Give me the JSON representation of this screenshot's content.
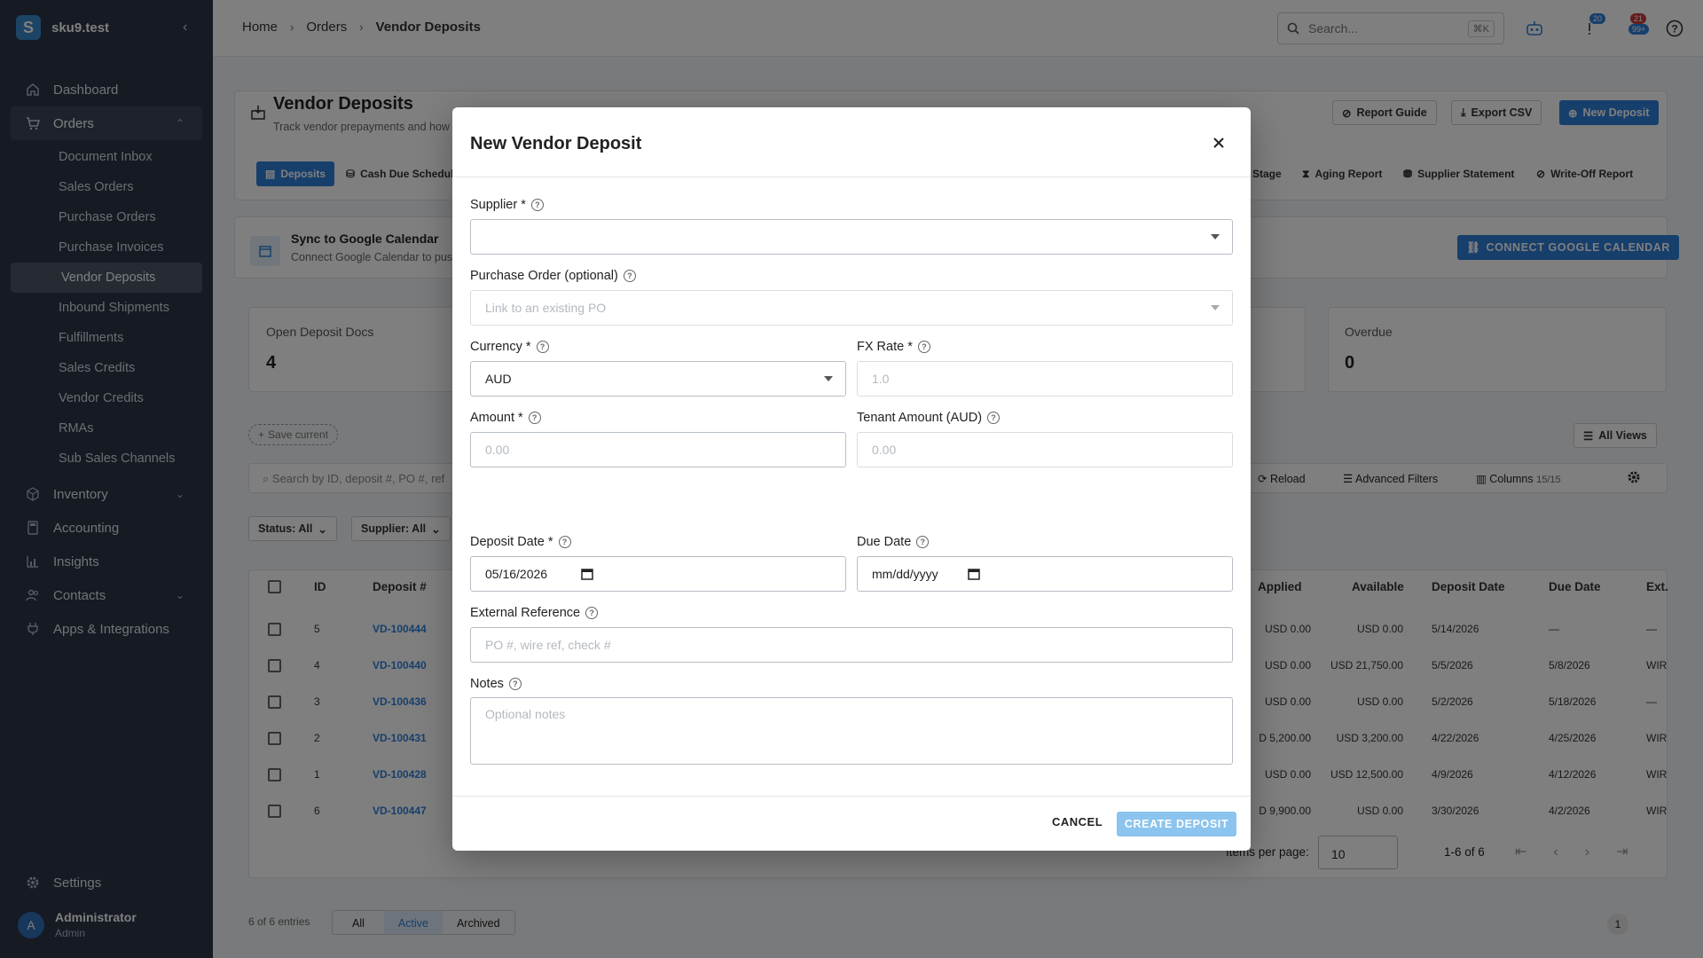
{
  "brand": {
    "logo": "S",
    "name": "sku9.test"
  },
  "sidebar": {
    "items": [
      {
        "label": "Dashboard",
        "icon": "home-icon"
      },
      {
        "label": "Orders",
        "icon": "cart-icon"
      },
      {
        "label": "Inventory",
        "icon": "box-icon"
      },
      {
        "label": "Accounting",
        "icon": "calculator-icon"
      },
      {
        "label": "Insights",
        "icon": "chart-icon"
      },
      {
        "label": "Contacts",
        "icon": "people-icon"
      },
      {
        "label": "Apps & Integrations",
        "icon": "plug-icon"
      }
    ],
    "orders_sub": [
      "Document Inbox",
      "Sales Orders",
      "Purchase Orders",
      "Purchase Invoices",
      "Vendor Deposits",
      "Inbound Shipments",
      "Fulfillments",
      "Sales Credits",
      "Vendor Credits",
      "RMAs",
      "Sub Sales Channels"
    ],
    "settings": "Settings",
    "user": {
      "initial": "A",
      "name": "Administrator",
      "role": "Admin"
    }
  },
  "topbar": {
    "breadcrumbs": [
      "Home",
      "Orders",
      "Vendor Deposits"
    ],
    "search_placeholder": "Search...",
    "search_shortcut": "⌘K",
    "badge_one": "20",
    "badge_two_top": "21",
    "badge_two_bottom": "99+"
  },
  "page": {
    "title": "Vendor Deposits",
    "subtitle": "Track vendor prepayments and how",
    "buttons": {
      "report_guide": "Report Guide",
      "export_csv": "Export CSV",
      "new_deposit": "New Deposit"
    },
    "tabs": [
      "Deposits",
      "Cash Due Schedule",
      "Stage",
      "Aging Report",
      "Supplier Statement",
      "Write-Off Report"
    ],
    "sync": {
      "title": "Sync to Google Calendar",
      "sub": "Connect Google Calendar to pus",
      "button": "CONNECT GOOGLE CALENDAR"
    },
    "stats": {
      "open_label": "Open Deposit Docs",
      "open_value": "4",
      "overdue_label": "Overdue",
      "overdue_value": "0"
    },
    "save_current": "Save current",
    "all_views": "All Views",
    "search_placeholder": "Search by ID, deposit #, PO #, ref",
    "reload": "Reload",
    "advanced_filters": "Advanced Filters",
    "columns": "Columns",
    "columns_count": "15/15",
    "status_filter": "Status: All",
    "supplier_filter": "Supplier: All",
    "table": {
      "headers": [
        "ID",
        "Deposit #",
        "Applied",
        "Available",
        "Deposit Date",
        "Due Date",
        "Ext."
      ],
      "rows": [
        {
          "id": "5",
          "num": "VD-100444",
          "applied": "USD 0.00",
          "available": "USD 0.00",
          "date": "5/14/2026",
          "due": "—",
          "ext": "—"
        },
        {
          "id": "4",
          "num": "VD-100440",
          "applied": "USD 0.00",
          "available": "USD 21,750.00",
          "date": "5/5/2026",
          "due": "5/8/2026",
          "ext": "WIR"
        },
        {
          "id": "3",
          "num": "VD-100436",
          "applied": "USD 0.00",
          "available": "USD 0.00",
          "date": "5/2/2026",
          "due": "5/18/2026",
          "ext": "—"
        },
        {
          "id": "2",
          "num": "VD-100431",
          "applied": "D 5,200.00",
          "available": "USD 3,200.00",
          "date": "4/22/2026",
          "due": "4/25/2026",
          "ext": "WIR"
        },
        {
          "id": "1",
          "num": "VD-100428",
          "applied": "USD 0.00",
          "available": "USD 12,500.00",
          "date": "4/9/2026",
          "due": "4/12/2026",
          "ext": "WIR"
        },
        {
          "id": "6",
          "num": "VD-100447",
          "applied": "D 9,900.00",
          "available": "USD 0.00",
          "date": "3/30/2026",
          "due": "4/2/2026",
          "ext": "WIR"
        }
      ]
    },
    "items_per_page_label": "Items per page:",
    "items_per_page": "10",
    "range": "1-6 of 6",
    "entries": "6 of 6 entries",
    "view_tabs": [
      "All",
      "Active",
      "Archived"
    ],
    "page_num": "1"
  },
  "modal": {
    "title": "New Vendor Deposit",
    "supplier_label": "Supplier *",
    "supplier_value": "",
    "po_label": "Purchase Order (optional)",
    "po_placeholder": "Link to an existing PO",
    "currency_label": "Currency *",
    "currency_value": "AUD",
    "fx_label": "FX Rate *",
    "fx_placeholder": "1.0",
    "amount_label": "Amount *",
    "amount_placeholder": "0.00",
    "tenant_label": "Tenant Amount (AUD)",
    "tenant_placeholder": "0.00",
    "deposit_date_label": "Deposit Date *",
    "deposit_date_value": "05/16/2026",
    "due_date_label": "Due Date",
    "due_date_placeholder": "mm/dd/yyyy",
    "ext_ref_label": "External Reference",
    "ext_ref_placeholder": "PO #, wire ref, check #",
    "notes_label": "Notes",
    "notes_placeholder": "Optional notes",
    "cancel": "CANCEL",
    "create": "CREATE DEPOSIT"
  }
}
